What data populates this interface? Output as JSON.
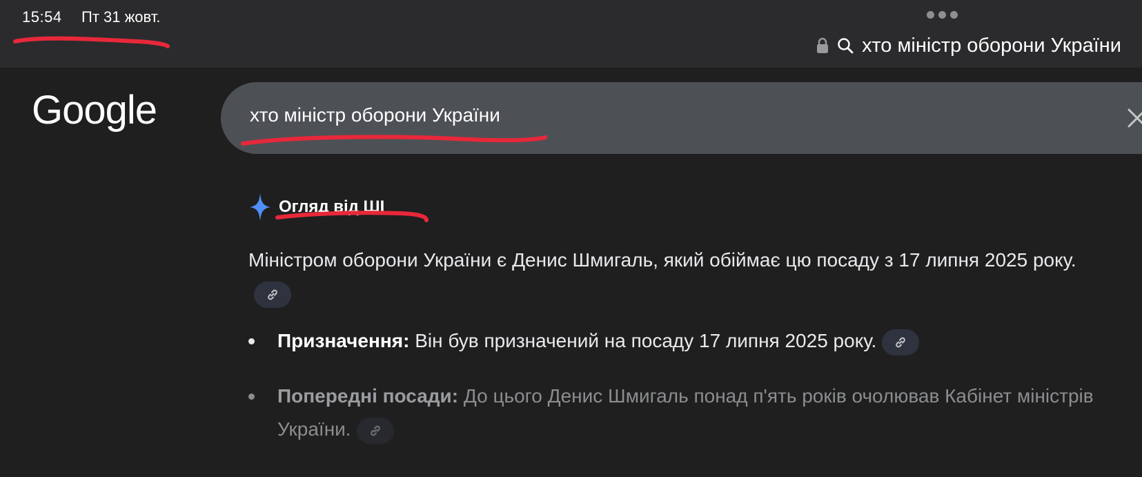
{
  "status_bar": {
    "time": "15:54",
    "date": "Пт 31 жовт."
  },
  "browser": {
    "address_text": "хто міністр оборони України",
    "icons": [
      "lock-icon",
      "search-icon",
      "more-dots-icon"
    ]
  },
  "google": {
    "logo": "Google",
    "search_query": "хто міністр оборони України",
    "clear_icon": "close-icon"
  },
  "ai_overview": {
    "title": "Огляд від ШІ",
    "icon": "sparkle-icon",
    "summary": "Міністром оборони України є Денис Шмигаль, який обіймає цю посаду з 17 липня 2025 року.",
    "bullets": [
      {
        "label": "Призначення:",
        "text": " Він був призначений на посаду 17 липня 2025 року."
      },
      {
        "label": "Попередні посади:",
        "text": " До цього Денис Шмигаль понад п'ять років очолював Кабінет міністрів України."
      }
    ]
  },
  "colors": {
    "page_background": "#1f1f1f",
    "top_bar": "#2b2b2d",
    "search_box": "#4d5156",
    "annotation_red": "#e8283a",
    "sparkle_blue": "#4f8ff7"
  }
}
